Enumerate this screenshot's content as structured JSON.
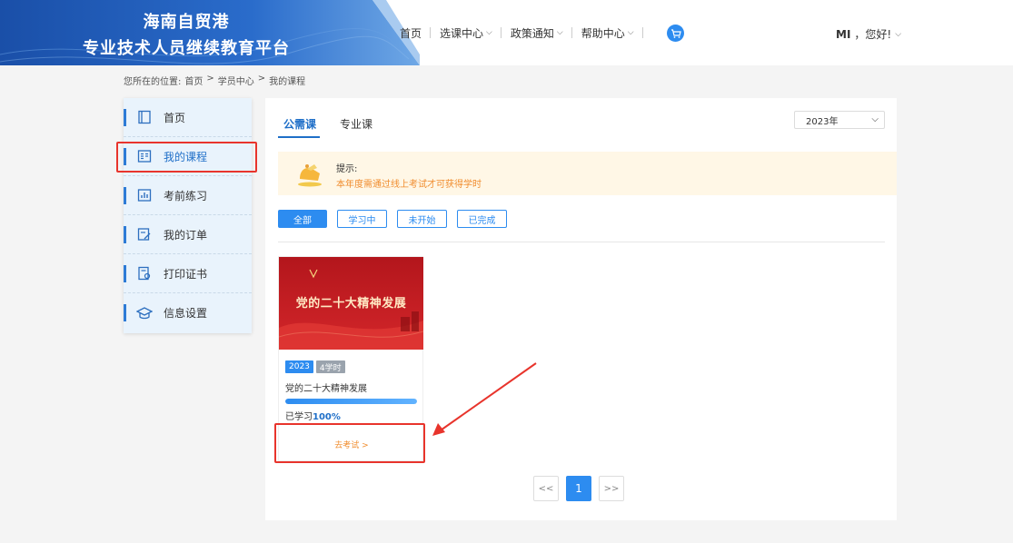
{
  "header": {
    "logo_line1": "海南自贸港",
    "logo_line2": "专业技术人员继续教育平台",
    "nav": [
      {
        "label": "首页"
      },
      {
        "label": "选课中心"
      },
      {
        "label": "政策通知"
      },
      {
        "label": "帮助中心"
      }
    ],
    "cart_icon": "cart-icon",
    "user_name": "MI",
    "greeting": "，您好!"
  },
  "breadcrumb": {
    "prefix": "您所在的位置:",
    "items": [
      "首页",
      "学员中心",
      "我的课程"
    ],
    "separator": ">"
  },
  "sidebar": {
    "items": [
      {
        "label": "首页",
        "icon": "book-icon"
      },
      {
        "label": "我的课程",
        "icon": "course-list-icon"
      },
      {
        "label": "考前练习",
        "icon": "chart-icon"
      },
      {
        "label": "我的订单",
        "icon": "order-icon"
      },
      {
        "label": "打印证书",
        "icon": "certificate-icon"
      },
      {
        "label": "信息设置",
        "icon": "graduation-cap-icon"
      }
    ],
    "active_index": 1
  },
  "main": {
    "tabs": [
      {
        "label": "公需课",
        "active": true
      },
      {
        "label": "专业课",
        "active": false
      }
    ],
    "year_select": "2023年",
    "notice": {
      "title": "提示:",
      "text": "本年度需通过线上考试才可获得学时"
    },
    "filters": [
      {
        "label": "全部",
        "active": true
      },
      {
        "label": "学习中",
        "active": false
      },
      {
        "label": "未开始",
        "active": false
      },
      {
        "label": "已完成",
        "active": false
      }
    ],
    "course": {
      "cover_title": "党的二十大精神发展",
      "year": "2023",
      "hours": "4学时",
      "title": "党的二十大精神发展",
      "progress_prefix": "已学习",
      "progress_value": "100%",
      "progress_fraction": 1.0,
      "exam_link": "去考试 >"
    },
    "pagination": {
      "prev": "<<",
      "current": "1",
      "next": ">>"
    }
  },
  "colors": {
    "primary": "#2d8cf0",
    "header_blue": "#1d5fb5",
    "highlight_red": "#e8342c",
    "notice_orange": "#f08c2d"
  }
}
